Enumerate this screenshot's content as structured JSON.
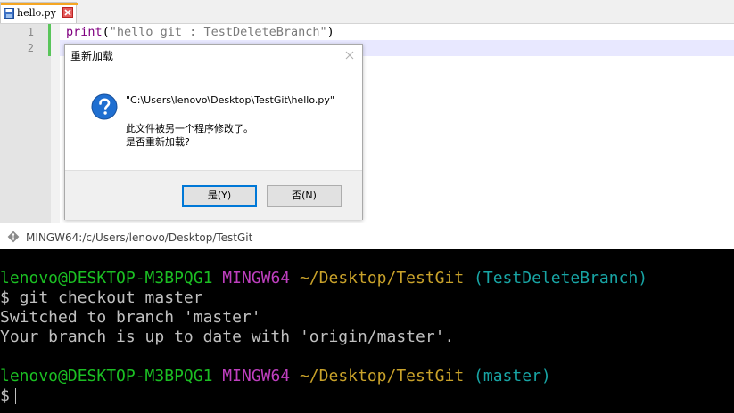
{
  "editor": {
    "tab": {
      "label": "hello.py"
    },
    "line_numbers": [
      "1",
      "2"
    ],
    "code": {
      "line1": {
        "func": "print",
        "open": "(",
        "string": "\"hello git : TestDeleteBranch\"",
        "close": ")"
      }
    }
  },
  "dialog": {
    "title": "重新加载",
    "path": "\"C:\\Users\\lenovo\\Desktop\\TestGit\\hello.py\"",
    "message_line1": "此文件被另一个程序修改了。",
    "message_line2": "是否重新加载?",
    "yes_label": "是(Y)",
    "no_label": "否(N)"
  },
  "terminal": {
    "title": "MINGW64:/c/Users/lenovo/Desktop/TestGit",
    "prompt1": {
      "user": "lenovo@DESKTOP-M3BPQG1",
      "system": "MINGW64",
      "path": "~/Desktop/TestGit",
      "branch": "(TestDeleteBranch)"
    },
    "command": "$ git checkout master",
    "output1": "Switched to branch 'master'",
    "output2": "Your branch is up to date with 'origin/master'.",
    "prompt2": {
      "user": "lenovo@DESKTOP-M3BPQG1",
      "system": "MINGW64",
      "path": "~/Desktop/TestGit",
      "branch": "(master)"
    },
    "dollar": "$"
  },
  "colors": {
    "term_user": "#1bbf23",
    "term_system": "#bf3fbf",
    "term_path": "#c9a22a",
    "term_branch": "#18a5a5",
    "keyword": "#800080",
    "line_highlight": "#e8e8ff",
    "change_bar": "#59c55a"
  },
  "icons": [
    "save-icon",
    "close-icon",
    "question-icon",
    "git-icon"
  ]
}
